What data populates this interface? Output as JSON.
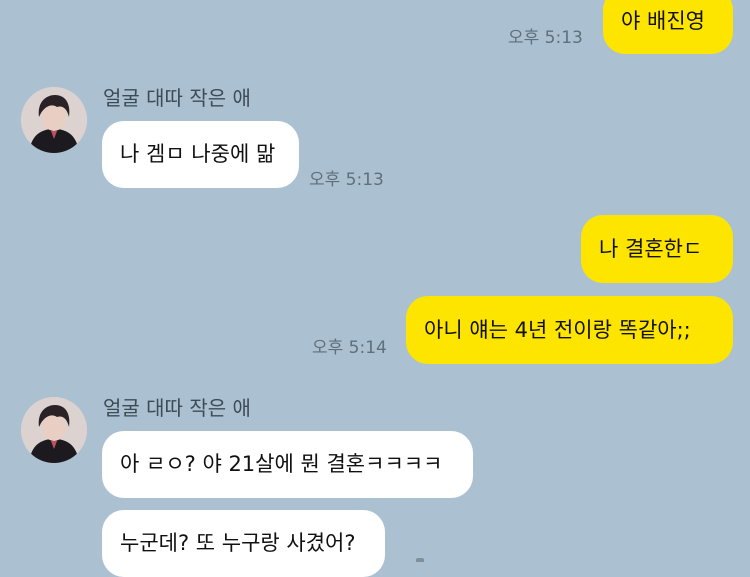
{
  "messages": [
    {
      "id": "m1",
      "side": "me",
      "text": "야 배진영",
      "time": "오후 5:13"
    },
    {
      "id": "m2",
      "side": "other",
      "sender": "얼굴 대따 작은 애",
      "text": "나 겜ㅁ 나중에 맒",
      "time": "오후 5:13"
    },
    {
      "id": "m3",
      "side": "me",
      "text": "나 결혼한ㄷ"
    },
    {
      "id": "m4",
      "side": "me",
      "text": "아니 얘는 4년 전이랑 똑같아;;",
      "time": "오후 5:14"
    },
    {
      "id": "m5",
      "side": "other",
      "sender": "얼굴 대따 작은 애",
      "text": "아 ㄹㅇ? 야 21살에 뭔 결혼ㅋㅋㅋㅋ"
    },
    {
      "id": "m6",
      "side": "other",
      "text": "누군데? 또 누구랑 사겼어?"
    }
  ],
  "colors": {
    "background": "#abc1d1",
    "my_bubble": "#fee500",
    "their_bubble": "#ffffff"
  },
  "icons": {
    "avatar": "profile-photo"
  }
}
